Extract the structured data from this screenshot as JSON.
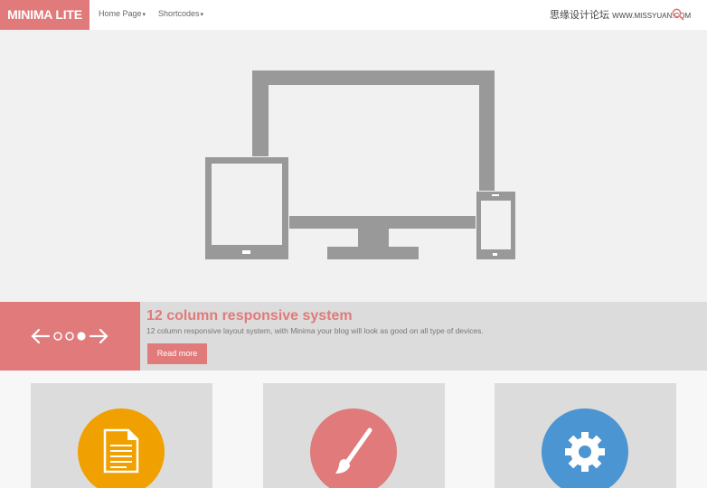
{
  "header": {
    "logo": "MINIMA LITE",
    "nav": [
      {
        "label": "Home Page",
        "caret": "▾"
      },
      {
        "label": "Shortcodes",
        "caret": "▾"
      }
    ],
    "watermark": {
      "cn": "思缘设计论坛",
      "site": "WWW.MISSYUAN.COM"
    }
  },
  "slide": {
    "title": "12 column responsive system",
    "description": "12 column responsive layout system, with Minima your blog will look as good on all type of devices.",
    "button": "Read more",
    "dots_count": 4,
    "active_dot": 3
  },
  "features": [
    {
      "icon": "document-icon",
      "color": "#f0a000"
    },
    {
      "icon": "paintbrush-icon",
      "color": "#e17a7a"
    },
    {
      "icon": "gear-icon",
      "color": "#4b95d2"
    }
  ],
  "colors": {
    "accent": "#e17a7a",
    "device": "#999999"
  }
}
